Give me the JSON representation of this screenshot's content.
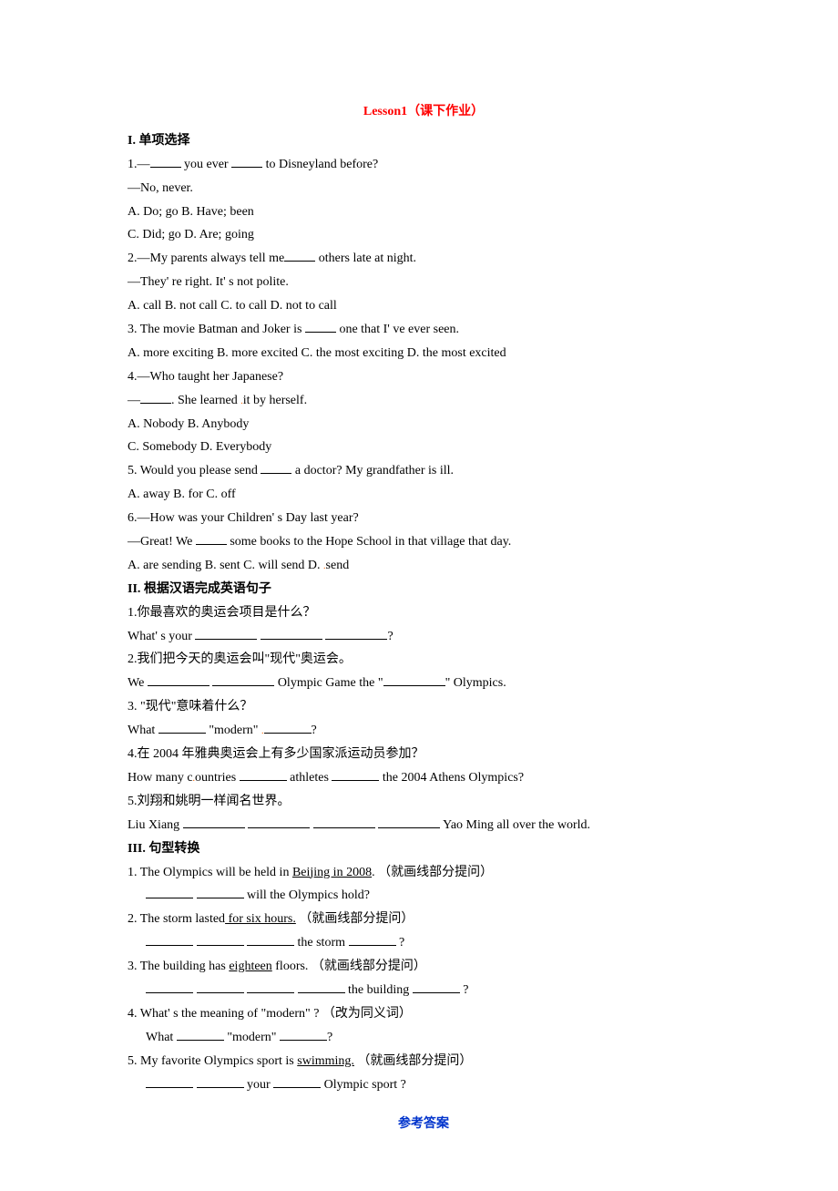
{
  "title": "Lesson1（课下作业）",
  "sections": {
    "s1": {
      "head": "I. 单项选择",
      "q1a": "1.—",
      "q1b": " you ever ",
      "q1c": " to Disneyland before?",
      "q1d": "—No, never.",
      "q1e": "A. Do; go B. Have; been",
      "q1f": "C. Did; go D. Are; going",
      "q2a": "2.—My parents always tell me",
      "q2b": " others late at night.",
      "q2c": "—They' re right. It' s not polite.",
      "q2d": "A. call     B. not call    C. to call   D. not to call",
      "q3a": "3. The movie Batman and Joker is ",
      "q3b": " one that I' ve ever seen.",
      "q3c": "A. more exciting B. more excited C. the most exciting D. the most excited",
      "q4a": "4.—Who taught her Japanese?",
      "q4b1": "—",
      "q4b2": ". She learned ",
      "q4b3": "it by herself.",
      "q4c": "A. Nobody B. Anybody",
      "q4d": "C. Somebody D. Everybody",
      "q5a": "5.  Would you please send ",
      "q5b": " a doctor? My grandfather is ill.",
      "q5c": "A. away B. for C. off",
      "q6a": "6.—How was your Children' s Day last year?",
      "q6b1": "—Great! We ",
      "q6b2": " some books to the Hope School in that village that day.",
      "q6c1": "A. are sending B. sent C. will send D. ",
      "q6c2": "send"
    },
    "s2": {
      "head": "II. 根据汉语完成英语句子",
      "q1a": "1.你最喜欢的奥运会项目是什么？",
      "q1b": "What' s your ",
      "q1c": "?",
      "q2a": "2.我们把今天的奥运会叫\"现代\"奥运会。",
      "q2b1": "We ",
      "q2b2": " Olympic Game the \"",
      "q2b3": "\" Olympics.",
      "q3a": "3. \"现代\"意味着什么？",
      "q3b1": "What ",
      "q3b2": " \"modern\" ",
      "q3b3": "?",
      "q4a": "4.在 2004 年雅典奥运会上有多少国家派运动员参加？",
      "q4b1": "How many c",
      "q4b2": "ountries ",
      "q4b3": " athletes ",
      "q4b4": " the 2004 Athens Olympics?",
      "q5a": "5.刘翔和姚明一样闻名世界。",
      "q5b1": "Liu Xiang ",
      "q5b2": " Yao Ming all over the world."
    },
    "s3": {
      "head": "III. 句型转换",
      "q1a1": "1. The Olympics will be held in ",
      "q1a2": "Beijing in 2008",
      "q1a3": ". （就画线部分提问）",
      "q1b": " will the Olympics hold?",
      "q2a1": "2. The storm lasted",
      "q2a2": " for six hours.",
      "q2a3": " （就画线部分提问）",
      "q2b1": " the storm ",
      "q2b2": " ?",
      "q3a1": "3. The building has ",
      "q3a2": "eighteen",
      "q3a3": " floors. （就画线部分提问）",
      "q3b1": " the building ",
      "q3b2": " ?",
      "q4a": "4. What' s the meaning of \"modern\" ? （改为同义词）",
      "q4b1": "What ",
      "q4b2": " \"modern\" ",
      "q4b3": "?",
      "q5a1": "5. My favorite Olympics sport is ",
      "q5a2": "swimming.",
      "q5a3": " （就画线部分提问）",
      "q5b1": " your ",
      "q5b2": " Olympic sport ?"
    }
  },
  "answers_head": "参考答案"
}
